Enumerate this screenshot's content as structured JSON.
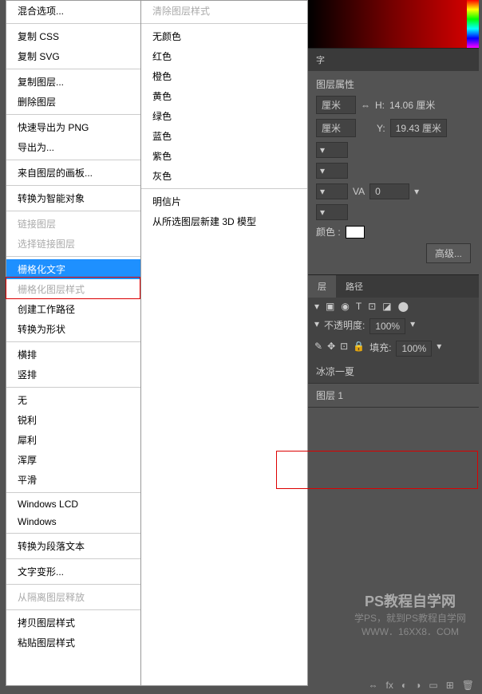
{
  "menu1": {
    "blend_options": "混合选项...",
    "copy_css": "复制 CSS",
    "copy_svg": "复制 SVG",
    "dup_layer": "复制图层...",
    "del_layer": "删除图层",
    "quick_export_png": "快速导出为 PNG",
    "export_as": "导出为...",
    "artboard_from": "来自图层的画板...",
    "convert_smart": "转换为智能对象",
    "link_layers": "链接图层",
    "select_linked": "选择链接图层",
    "rasterize_type": "栅格化文字",
    "rasterize_style": "栅格化图层样式",
    "create_work_path": "创建工作路径",
    "convert_shape": "转换为形状",
    "horizontal": "横排",
    "vertical": "竖排",
    "none": "无",
    "sharp": "锐利",
    "crisp": "犀利",
    "strong": "浑厚",
    "smooth": "平滑",
    "win_lcd": "Windows LCD",
    "windows": "Windows",
    "convert_para": "转换为段落文本",
    "warp_text": "文字变形...",
    "release_iso": "从隔离图层释放",
    "copy_style": "拷贝图层样式",
    "paste_style": "粘贴图层样式"
  },
  "menu2": {
    "clear_style": "清除图层样式",
    "no_color": "无颜色",
    "red": "红色",
    "orange": "橙色",
    "yellow": "黄色",
    "green": "绿色",
    "blue": "蓝色",
    "purple": "紫色",
    "gray": "灰色",
    "postcard": "明信片",
    "new_3d": "从所选图层新建 3D 模型"
  },
  "props": {
    "title": "图层属性",
    "unit": "厘米",
    "h_label": "H:",
    "h_val": "14.06 厘米",
    "y_label": "Y:",
    "y_val": "19.43 厘米",
    "va_label": "VA",
    "va_val": "0",
    "color_label": "颜色 :",
    "advanced": "高级..."
  },
  "layers": {
    "tab_layers": "图层",
    "tab_paths": "路径",
    "opacity_label": "不透明度:",
    "opacity_val": "100%",
    "fill_label": "填充:",
    "fill_val": "100%",
    "layer_text": "冰凉一夏",
    "layer1": "图层 1"
  },
  "watermark": {
    "big": "PS教程自学网",
    "line1": "学PS，就到PS教程自学网",
    "line2": "WWW．16XX8．COM"
  },
  "icons": {
    "link": "⇔",
    "fx": "fx",
    "mask": "◐",
    "adj": "◑",
    "folder": "▭",
    "new": "⊞",
    "trash": "🗑",
    "img": "▣",
    "eye": "◉",
    "t": "T",
    "crop": "⊡",
    "lock": "🔒",
    "dots": "⋯",
    "move": "✥",
    "arrows": "↕"
  }
}
